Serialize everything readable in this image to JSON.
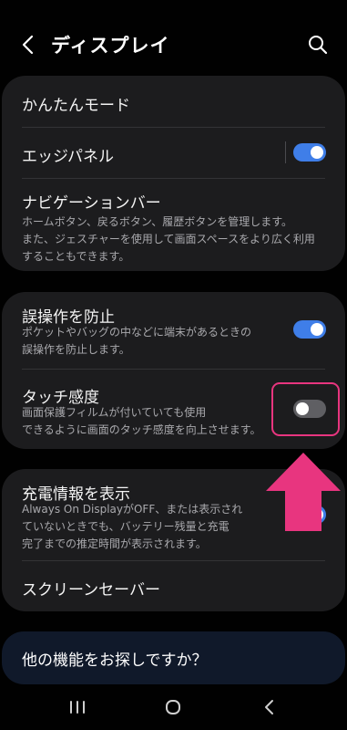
{
  "header": {
    "title": "ディスプレイ",
    "back_icon": "chevron-left-icon",
    "search_icon": "search-icon"
  },
  "card1": {
    "items": [
      {
        "title": "かんたんモード"
      },
      {
        "title": "エッジパネル",
        "toggle": "on"
      },
      {
        "title": "ナビゲーションバー",
        "desc": [
          "ホームボタン、戻るボタン、履歴ボタンを管理します。",
          "また、ジェスチャーを使用して画面スペースをより広く利用",
          "することもできます。"
        ]
      }
    ]
  },
  "card2": {
    "items": [
      {
        "title": "誤操作を防止",
        "desc": [
          "ポケットやバッグの中などに端末があるときの",
          "誤操作を防止します。"
        ],
        "toggle": "on"
      },
      {
        "title": "タッチ感度",
        "desc": [
          "画面保護フィルムが付いていても使用",
          "できるように画面のタッチ感度を向上させます。"
        ],
        "toggle": "off"
      }
    ]
  },
  "card3": {
    "items": [
      {
        "title": "充電情報を表示",
        "desc": [
          "Always On DisplayがOFF、または表示され",
          "ていないときでも、バッテリー残量と充電",
          "完了までの推定時間が表示されます。"
        ],
        "toggle": "on"
      },
      {
        "title": "スクリーンセーバー"
      }
    ]
  },
  "bottom": {
    "label": "他の機能をお探しですか？"
  },
  "navbar": {
    "icons": [
      "recents-icon",
      "home-icon",
      "back-icon"
    ]
  },
  "colors": {
    "accent": "#3f7ee8",
    "highlight": "#e8357f",
    "card": "#1c1c1e"
  }
}
